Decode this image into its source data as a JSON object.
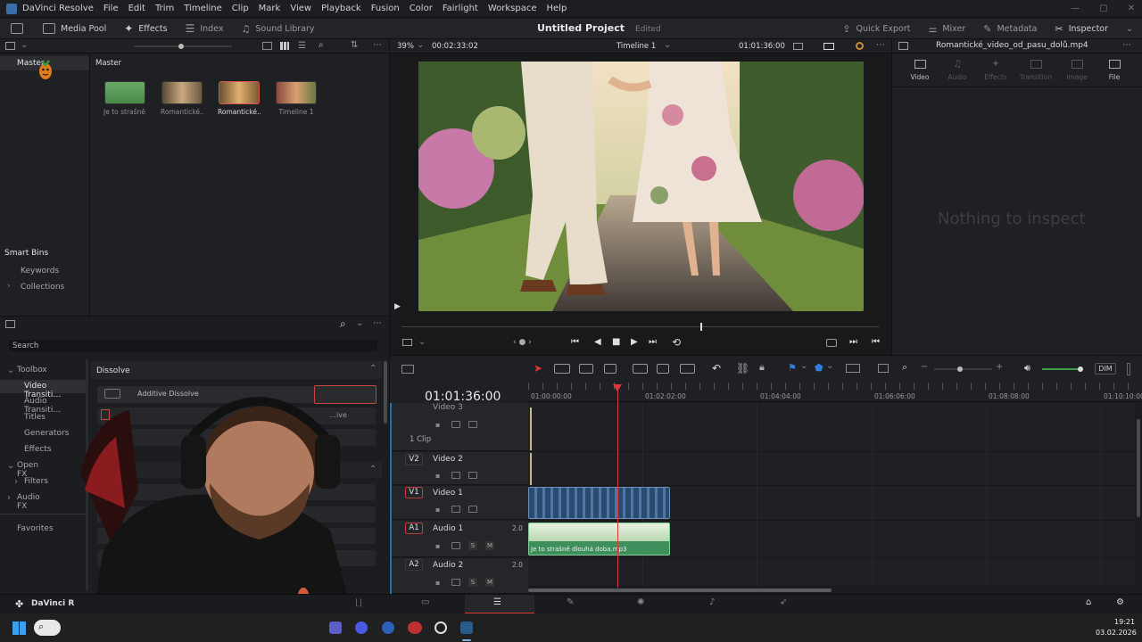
{
  "menubar": {
    "app": "DaVinci Resolve",
    "items": [
      "File",
      "Edit",
      "Trim",
      "Timeline",
      "Clip",
      "Mark",
      "View",
      "Playback",
      "Fusion",
      "Color",
      "Fairlight",
      "Workspace",
      "Help"
    ]
  },
  "toolbar": {
    "media_pool": "Media Pool",
    "effects": "Effects",
    "index": "Index",
    "sound_library": "Sound Library",
    "project_title": "Untitled Project",
    "project_status": "Edited",
    "quick_export": "Quick Export",
    "mixer": "Mixer",
    "metadata": "Metadata",
    "inspector": "Inspector"
  },
  "viewer_bar": {
    "zoom": "39%",
    "duration": "00:02:33:02",
    "timeline_name": "Timeline 1",
    "timecode": "01:01:36:00"
  },
  "media_pool": {
    "bin_header": "Master",
    "tree_root": "Master",
    "clips": [
      {
        "label": "Je to strašně…",
        "color": "#5a9a55"
      },
      {
        "label": "Romantické…",
        "color": "#8a6a4a"
      },
      {
        "label": "Romantické…",
        "color": "#9a6a3c"
      },
      {
        "label": "Timeline 1",
        "color": "#a05a4a"
      }
    ],
    "smart_bins": "Smart Bins",
    "keywords": "Keywords",
    "collections": "Collections"
  },
  "effects": {
    "search_label": "Search",
    "tree": [
      {
        "label": "Toolbox",
        "indent": 0
      },
      {
        "label": "Video Transiti…",
        "indent": 1,
        "selected": true
      },
      {
        "label": "Audio Transiti…",
        "indent": 1
      },
      {
        "label": "Titles",
        "indent": 1
      },
      {
        "label": "Generators",
        "indent": 1
      },
      {
        "label": "Effects",
        "indent": 1
      },
      {
        "label": "Open FX",
        "indent": 0
      },
      {
        "label": "Filters",
        "indent": 1
      },
      {
        "label": "Audio FX",
        "indent": 0
      }
    ],
    "favorites": "Favorites",
    "section": "Dissolve",
    "items": [
      "Additive Dissolve",
      "…ive"
    ]
  },
  "inspector": {
    "file_name": "Romantické_video_od_pasu_dolů.mp4",
    "tabs": [
      "Video",
      "Audio",
      "Effects",
      "Transition",
      "Image",
      "File"
    ],
    "empty_message": "Nothing to inspect"
  },
  "timeline": {
    "timecode": "01:01:36:00",
    "ruler": [
      "01:00:00:00",
      "01:02:02:00",
      "01:04:04:00",
      "01:06:06:00",
      "01:08:08:00",
      "01:10:10:00"
    ],
    "tracks": [
      {
        "id": "V3",
        "name": "Video 3",
        "extra": "1 Clip"
      },
      {
        "id": "V2",
        "name": "Video 2"
      },
      {
        "id": "V1",
        "name": "Video 1"
      },
      {
        "id": "A1",
        "name": "Audio 1",
        "level": "2.0"
      },
      {
        "id": "A2",
        "name": "Audio 2",
        "level": "2.0"
      }
    ],
    "audio_clip_label": "Je to strašně dlouhá doba.mp3",
    "dim_label": "DIM",
    "solo": "S",
    "mute": "M"
  },
  "page_bar": {
    "app_label": "DaVinci R"
  },
  "taskbar": {
    "time": "19:21",
    "date": "03.02.2026"
  },
  "colors": {
    "accent_red": "#e0353a",
    "video_clip": "#3a5f8a",
    "audio_clip": "#3f8f5c"
  }
}
